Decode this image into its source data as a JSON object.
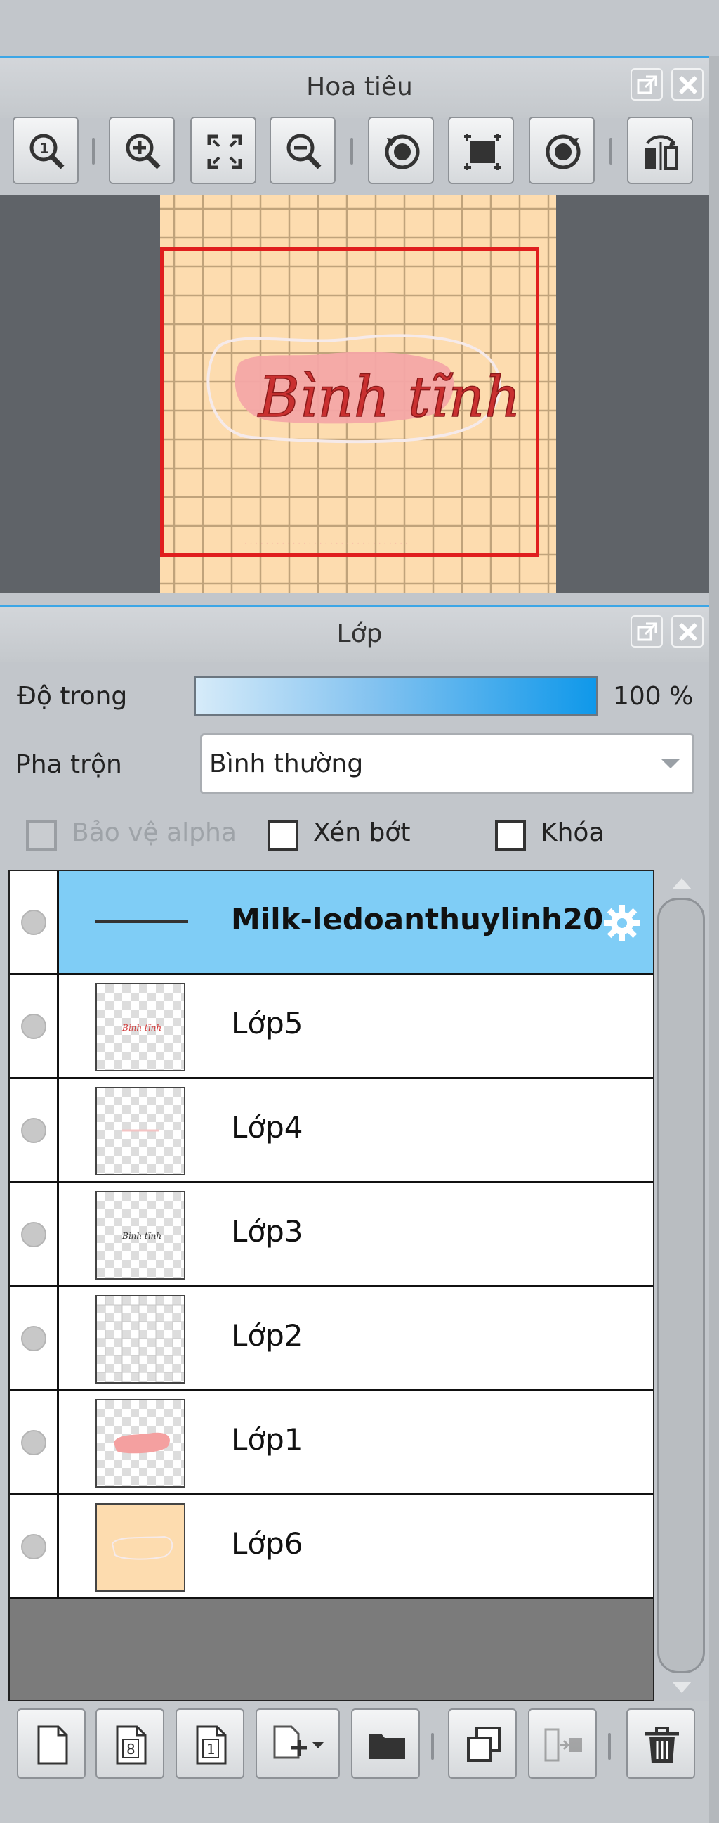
{
  "navigator": {
    "title": "Hoa tiêu",
    "toolbar": [
      "zoom-actual-size",
      "zoom-in",
      "fit-to-window",
      "zoom-out",
      "rotate-left",
      "reset-view",
      "rotate-right",
      "flip-horizontal"
    ],
    "canvas_text": "Bình tĩnh"
  },
  "layers_panel": {
    "title": "Lớp",
    "opacity_label": "Độ trong",
    "opacity_value": "100 %",
    "opacity_fraction": 1.0,
    "blend_label": "Pha trộn",
    "blend_value": "Bình thường",
    "protect_alpha_label": "Bảo vệ alpha",
    "clipping_label": "Xén bớt",
    "lock_label": "Khóa",
    "layers": [
      {
        "name": "Milk-ledoanthuylinh20",
        "selected": true,
        "type": "text"
      },
      {
        "name": "Lớp5",
        "selected": false,
        "type": "transparent"
      },
      {
        "name": "Lớp4",
        "selected": false,
        "type": "transparent"
      },
      {
        "name": "Lớp3",
        "selected": false,
        "type": "transparent"
      },
      {
        "name": "Lớp2",
        "selected": false,
        "type": "transparent"
      },
      {
        "name": "Lớp1",
        "selected": false,
        "type": "transparent"
      },
      {
        "name": "Lớp6",
        "selected": false,
        "type": "filled"
      }
    ],
    "bottom_toolbar": [
      "new-layer",
      "new-8bit-layer",
      "new-1bit-layer",
      "add-layer-menu",
      "new-folder",
      "duplicate-layer",
      "merge-down",
      "delete-layer"
    ]
  },
  "colors": {
    "accent": "#3ca6e6",
    "selection": "#7fcdf6",
    "canvas_bg": "#fddcaf",
    "view_rect": "#e01e1e"
  }
}
